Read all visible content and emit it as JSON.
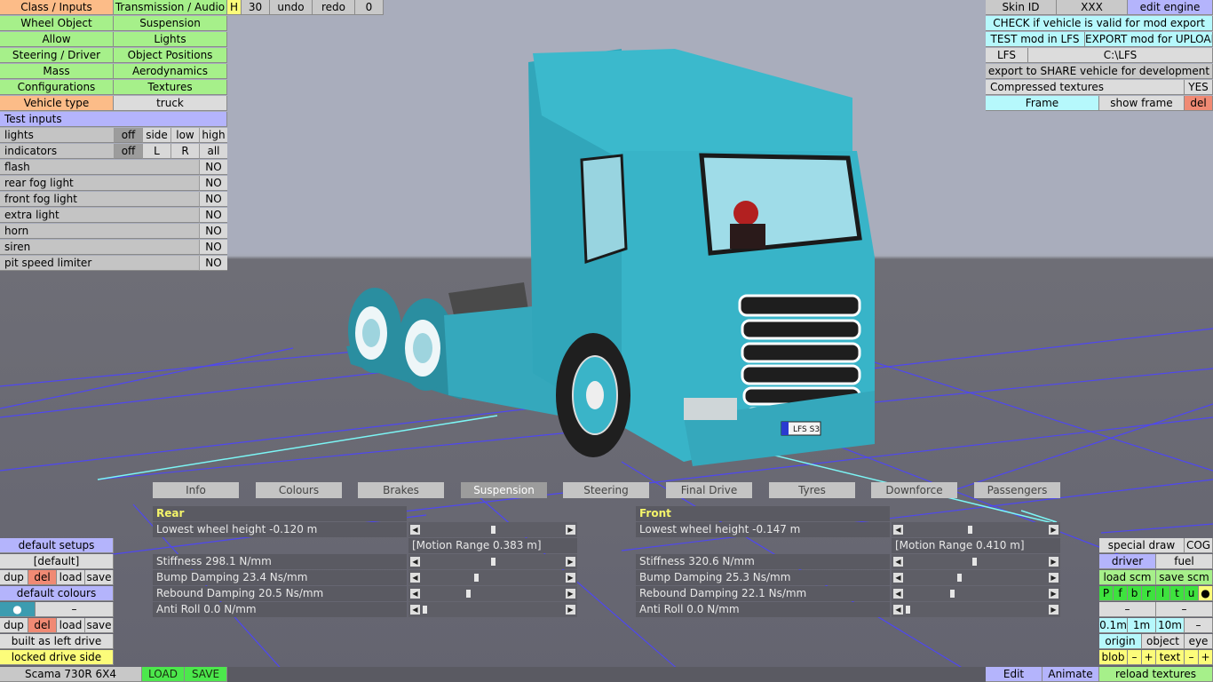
{
  "top_left": {
    "class_inputs": "Class / Inputs",
    "transmission_audio": "Transmission / Audio",
    "h": "H",
    "thirty": "30",
    "undo": "undo",
    "redo": "redo",
    "zero": "0",
    "wheel_object": "Wheel Object",
    "suspension": "Suspension",
    "allow": "Allow",
    "lights": "Lights",
    "steering_driver": "Steering / Driver",
    "object_positions": "Object Positions",
    "mass": "Mass",
    "aerodynamics": "Aerodynamics",
    "configurations": "Configurations",
    "textures": "Textures",
    "vehicle_type_label": "Vehicle type",
    "vehicle_type_value": "truck"
  },
  "test_inputs": {
    "title": "Test inputs",
    "lights": {
      "label": "lights",
      "opts": [
        "off",
        "side",
        "low",
        "high"
      ]
    },
    "indicators": {
      "label": "indicators",
      "opts": [
        "off",
        "L",
        "R",
        "all"
      ]
    },
    "rows": [
      {
        "label": "flash",
        "value": "NO"
      },
      {
        "label": "rear fog light",
        "value": "NO"
      },
      {
        "label": "front fog light",
        "value": "NO"
      },
      {
        "label": "extra light",
        "value": "NO"
      },
      {
        "label": "horn",
        "value": "NO"
      },
      {
        "label": "siren",
        "value": "NO"
      },
      {
        "label": "pit speed limiter",
        "value": "NO"
      }
    ]
  },
  "top_right": {
    "skin_id": "Skin ID",
    "skin_value": "XXX",
    "edit_engine": "edit engine",
    "check_valid": "CHECK if vehicle is valid for mod export",
    "test_mod": "TEST mod in LFS",
    "export_upload": "EXPORT mod for UPLOAD",
    "lfs": "LFS",
    "lfs_path": "C:\\LFS",
    "export_share": "export to SHARE vehicle for development",
    "compressed_textures": "Compressed textures",
    "compressed_value": "YES",
    "frame": "Frame",
    "show_frame": "show frame",
    "del": "del"
  },
  "scene": {
    "plate": "LFS S3"
  },
  "tabs": [
    "Info",
    "Colours",
    "Brakes",
    "Suspension",
    "Steering",
    "Final Drive",
    "Tyres",
    "Downforce",
    "Passengers"
  ],
  "active_tab": "Suspension",
  "suspension": {
    "rear": {
      "title": "Rear",
      "lowest_height": "Lowest wheel height -0.120 m",
      "lowest_height_pos": 0.5,
      "motion_range": "[Motion Range 0.383 m]",
      "params": [
        {
          "label": "Stiffness 298.1 N/mm",
          "pos": 0.5
        },
        {
          "label": "Bump Damping 23.4 Ns/mm",
          "pos": 0.38
        },
        {
          "label": "Rebound Damping 20.5 Ns/mm",
          "pos": 0.32
        },
        {
          "label": "Anti Roll 0.0 N/mm",
          "pos": 0.0
        }
      ]
    },
    "front": {
      "title": "Front",
      "lowest_height": "Lowest wheel height -0.147 m",
      "lowest_height_pos": 0.46,
      "motion_range": "[Motion Range 0.410 m]",
      "params": [
        {
          "label": "Stiffness 320.6 N/mm",
          "pos": 0.49
        },
        {
          "label": "Bump Damping 25.3 Ns/mm",
          "pos": 0.38
        },
        {
          "label": "Rebound Damping 22.1 Ns/mm",
          "pos": 0.33
        },
        {
          "label": "Anti Roll 0.0 N/mm",
          "pos": 0.0
        }
      ]
    }
  },
  "bottom_left": {
    "default_setups": "default setups",
    "default": "[default]",
    "dup": "dup",
    "del": "del",
    "load": "load",
    "save": "save",
    "default_colours": "default colours",
    "dot": "●",
    "dash": "–",
    "built_left": "built as left drive",
    "locked_side": "locked drive side",
    "vehicle_name": "Scama 730R 6X4",
    "LOAD": "LOAD",
    "SAVE": "SAVE"
  },
  "bottom_right": {
    "special_draw": "special draw",
    "cog": "COG",
    "driver": "driver",
    "fuel": "fuel",
    "load_scm": "load scm",
    "save_scm": "save scm",
    "letters": [
      "P",
      "f",
      "b",
      "r",
      "l",
      "t",
      "u",
      "●"
    ],
    "dash": "–",
    "m01": "0.1m",
    "m1": "1m",
    "m10": "10m",
    "origin": "origin",
    "object": "object",
    "eye": "eye",
    "blob": "blob",
    "minus": "–",
    "plus": "+",
    "text": "text",
    "reload_textures": "reload textures",
    "edit": "Edit",
    "animate": "Animate"
  }
}
